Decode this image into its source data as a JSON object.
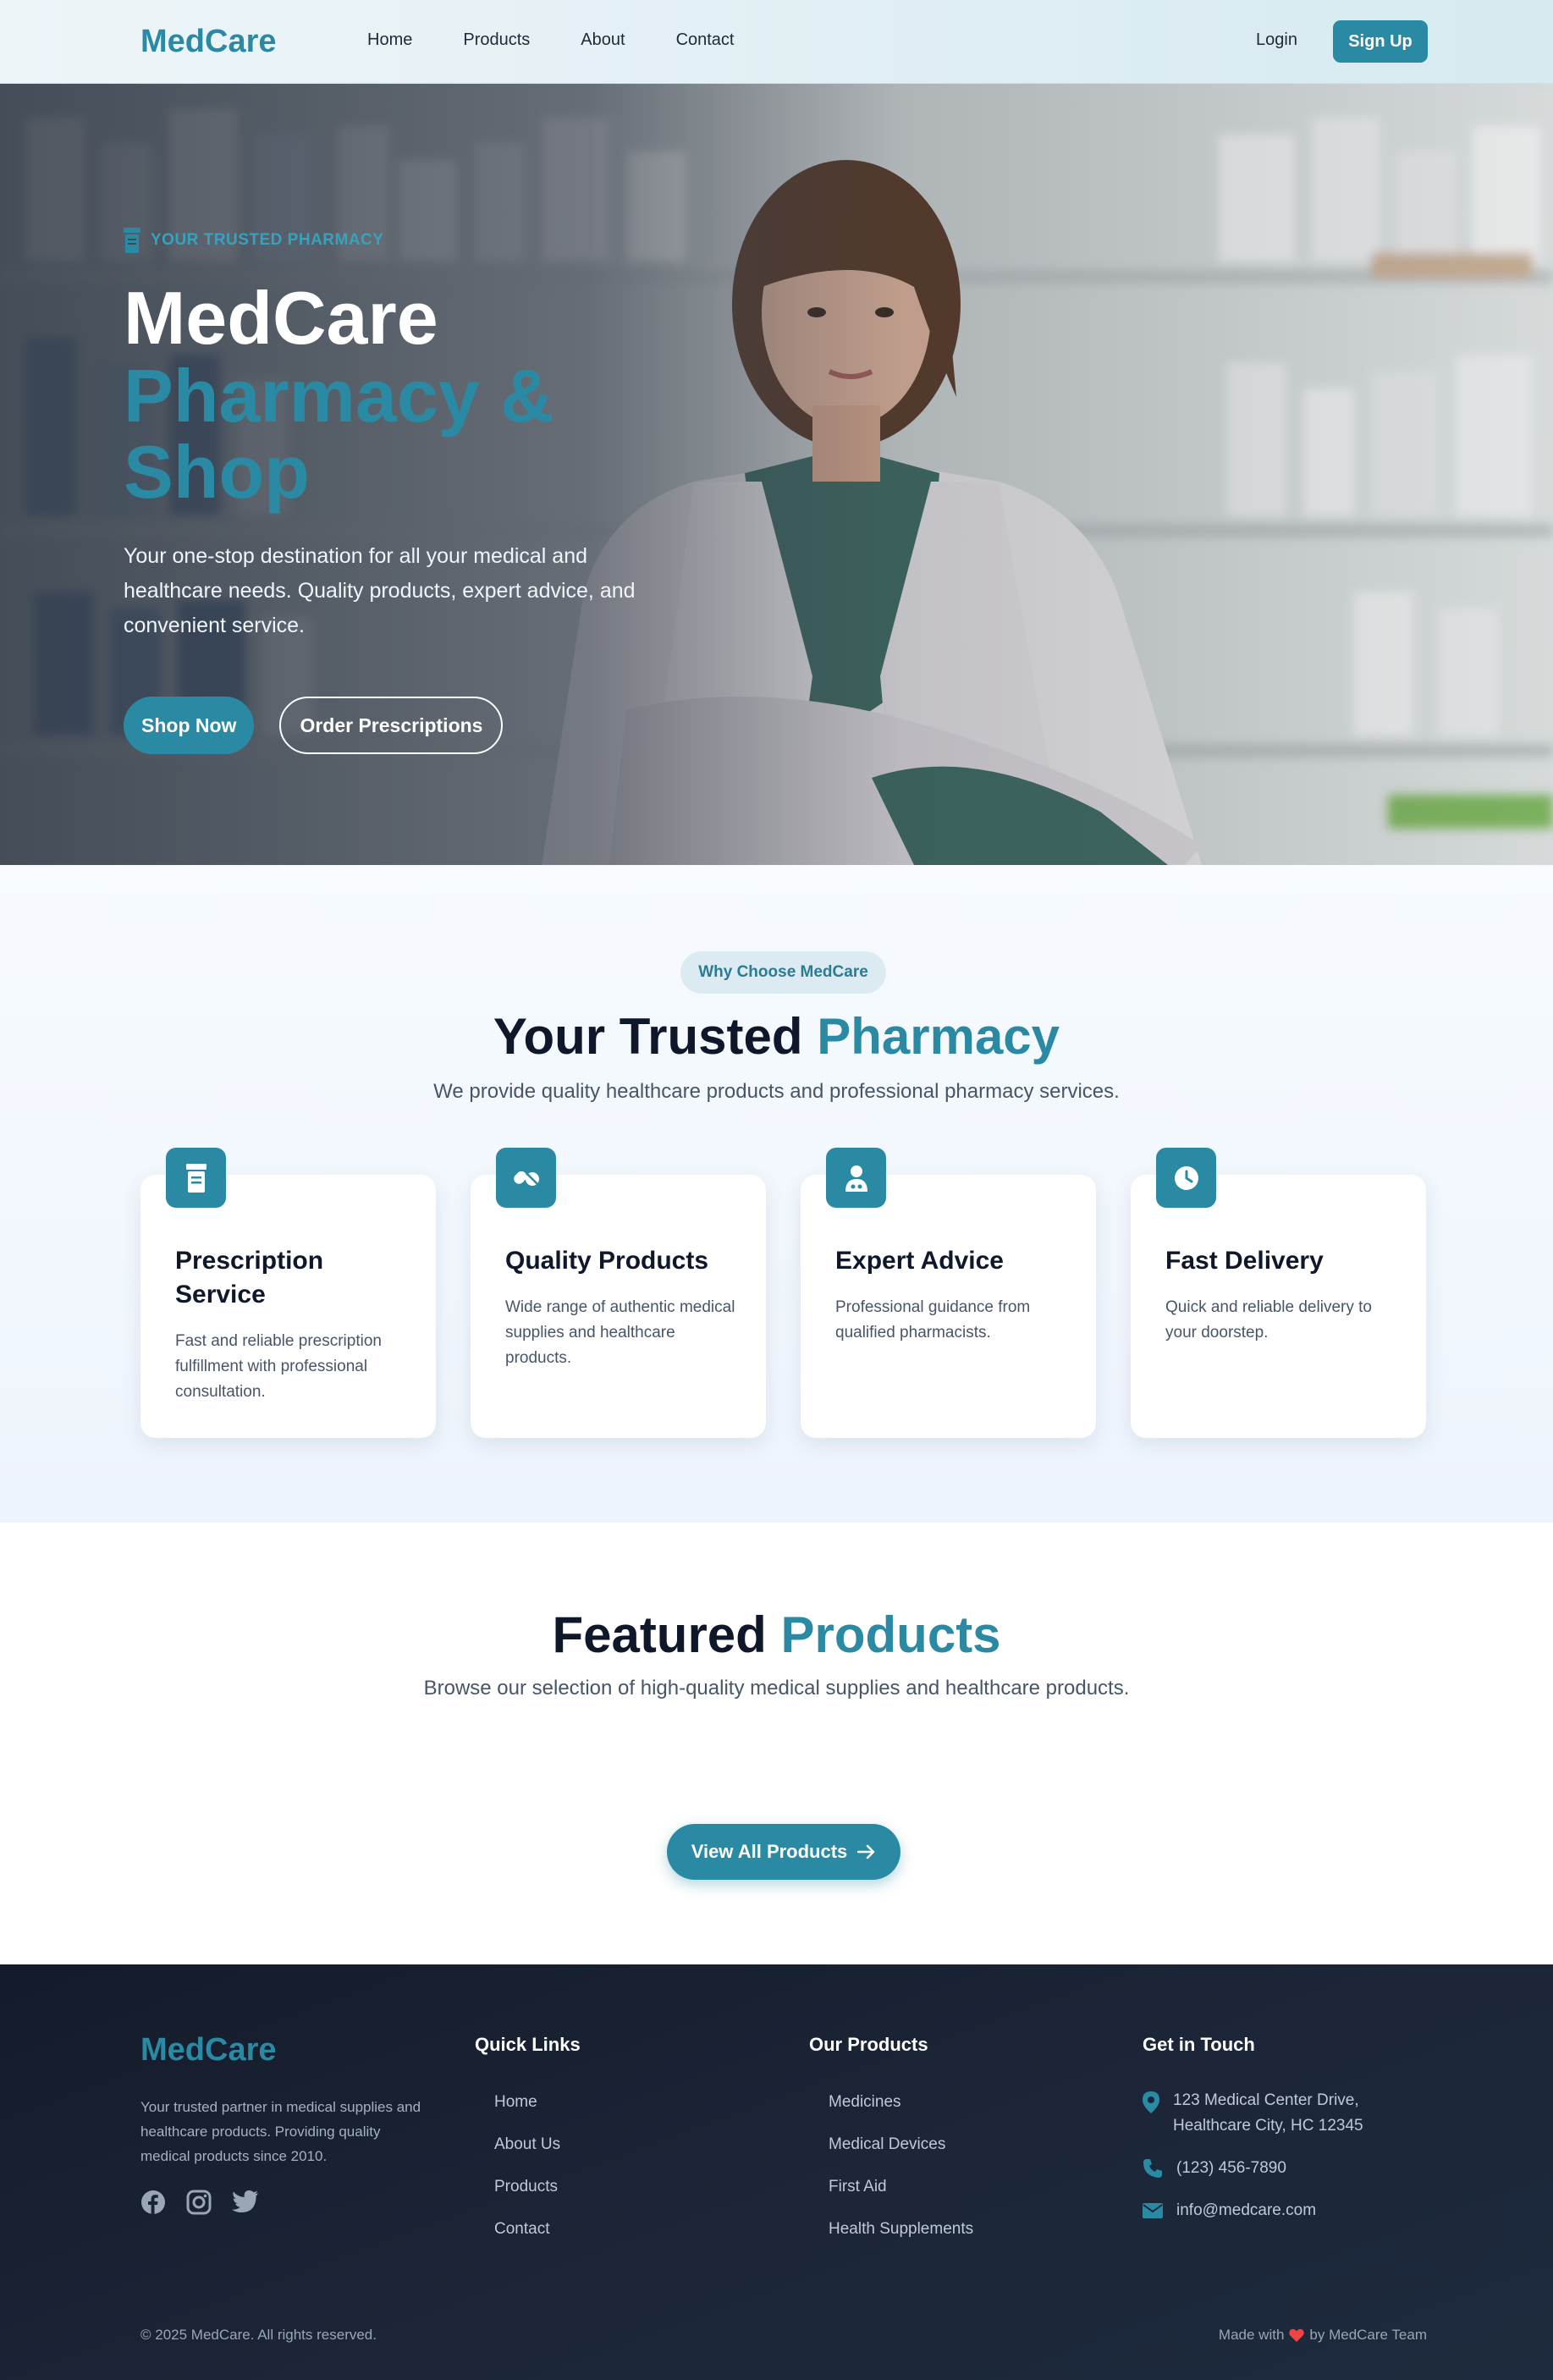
{
  "brand": "MedCare",
  "nav": {
    "links": [
      "Home",
      "Products",
      "About",
      "Contact"
    ],
    "login": "Login",
    "signup": "Sign Up"
  },
  "hero": {
    "eyebrow": "YOUR TRUSTED PHARMACY",
    "title_line1": "MedCare",
    "title_line2": "Pharmacy &",
    "title_line3": "Shop",
    "description": "Your one-stop destination for all your medical and healthcare needs. Quality products, expert advice, and convenient service.",
    "primary_cta": "Shop Now",
    "secondary_cta": "Order Prescriptions"
  },
  "why": {
    "pill": "Why Choose MedCare",
    "title_plain": "Your Trusted",
    "title_accent": "Pharmacy",
    "subtitle": "We provide quality healthcare products and professional pharmacy services.",
    "cards": [
      {
        "icon": "prescription-bottle-icon",
        "title": "Prescription Service",
        "desc": "Fast and reliable prescription fulfillment with professional consultation."
      },
      {
        "icon": "pills-icon",
        "title": "Quality Products",
        "desc": "Wide range of authentic medical supplies and healthcare products."
      },
      {
        "icon": "doctor-icon",
        "title": "Expert Advice",
        "desc": "Professional guidance from qualified pharmacists."
      },
      {
        "icon": "clock-icon",
        "title": "Fast Delivery",
        "desc": "Quick and reliable delivery to your doorstep."
      }
    ]
  },
  "featured": {
    "title_plain": "Featured",
    "title_accent": "Products",
    "subtitle": "Browse our selection of high-quality medical supplies and healthcare products.",
    "cta": "View All Products"
  },
  "footer": {
    "brand": "MedCare",
    "about": "Your trusted partner in medical supplies and healthcare products. Providing quality medical products since 2010.",
    "quick_links_title": "Quick Links",
    "quick_links": [
      "Home",
      "About Us",
      "Products",
      "Contact"
    ],
    "products_title": "Our Products",
    "products": [
      "Medicines",
      "Medical Devices",
      "First Aid",
      "Health Supplements"
    ],
    "contact_title": "Get in Touch",
    "address_line1": "123 Medical Center Drive,",
    "address_line2": "Healthcare City, HC 12345",
    "phone": "(123) 456-7890",
    "email": "info@medcare.com",
    "copyright": "© 2025 MedCare. All rights reserved.",
    "made_with_prefix": "Made with",
    "made_with_suffix": "by MedCare Team"
  },
  "colors": {
    "accent": "#2b8aa3",
    "heart": "#ef4444",
    "footer_bg": "#1c2638"
  }
}
